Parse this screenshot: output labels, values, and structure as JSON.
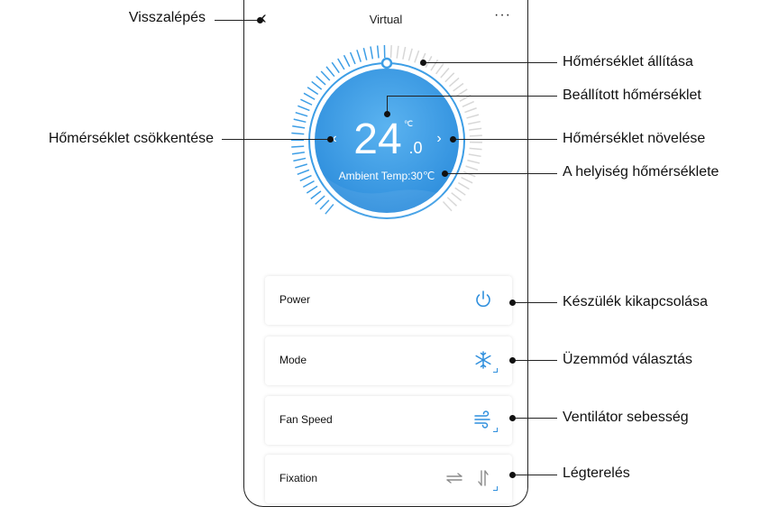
{
  "app": {
    "title": "Virtual",
    "more_label": "···"
  },
  "thermostat": {
    "setpoint_integer": "24",
    "setpoint_decimal": ".0",
    "unit": "℃",
    "ambient_label": "Ambient Temp:30℃",
    "decrease_label": "‹",
    "increase_label": "›",
    "accent_color": "#3d9ee6",
    "dial_inner_color": "#4ca8ec"
  },
  "controls": [
    {
      "label": "Power",
      "icon": "power-icon"
    },
    {
      "label": "Mode",
      "icon": "snowflake-icon"
    },
    {
      "label": "Fan Speed",
      "icon": "wind-icon"
    },
    {
      "label": "Fixation",
      "icon": "swing-icons"
    }
  ],
  "annotations": {
    "back": "Visszalépés",
    "decrease": "Hőmérséklet csökkentése",
    "adjust": "Hőmérséklet állítása",
    "setpoint": "Beállított hőmérséklet",
    "increase": "Hőmérséklet növelése",
    "room_temp": "A helyiség hőmérséklete",
    "power": "Készülék kikapcsolása",
    "mode": "Üzemmód választás",
    "fan": "Ventilátor sebesség",
    "swing": "Légterelés"
  }
}
